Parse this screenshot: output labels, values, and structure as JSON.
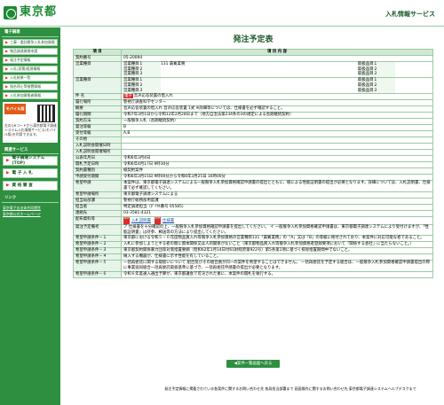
{
  "header": {
    "logo_text": "東京都",
    "service_title": "入札情報サービス"
  },
  "sidebar": {
    "heading": "電子調達",
    "menu": [
      "工事・委託競争入札参加資格",
      "物品調達資格申請",
      "発注予定情報",
      "入札(見積)経過情報",
      "入札結果一覧",
      "指名停止等措置情報",
      "入札参加資格者情報"
    ],
    "mobile_title": "モバイル版",
    "mobile_text": "左のQRコードから東京都電子調達システム入札情報サービス(モバイル版)を利用できます。",
    "heading2": "関連サービス",
    "btn1": "電子調達システム(TOP)",
    "btn2": "電 子 入 札",
    "btn3": "資 格 審 査",
    "heading3": "リンク",
    "links": [
      "東京電子自治体共同運営",
      "東京都公式ホームページ"
    ]
  },
  "main": {
    "page_title": "発注予定表",
    "col_item": "項 目",
    "col_content": "項 目 内 容",
    "rows": [
      {
        "label": "契約番号",
        "value": "05-20094"
      },
      {
        "label": "営業種目",
        "sub": [
          "営業種目１",
          "営業種目２",
          "営業種目３"
        ],
        "sub_val": [
          "131 貴賓業務",
          "",
          ""
        ],
        "right": [
          "取扱品目１",
          "取扱品目２",
          "取扱品目３"
        ]
      },
      {
        "label": "営業種目",
        "sub": [
          "営業種目１",
          "営業種目２",
          "営業種目３"
        ],
        "sub_val": [
          "",
          "",
          ""
        ],
        "right": [
          "取扱品目１",
          "取扱品目２",
          "取扱品目３"
        ]
      },
      {
        "label": "件 名",
        "badge": "電子",
        "value": "音声応答装置の借入れ"
      },
      {
        "label": "履行場所",
        "value": "警視庁調査科学センター"
      },
      {
        "label": "概要",
        "value": "音声応答装置の借入れ 音声応答装置 1式 ※詳細等については、仕様書を必ず確認すること。"
      },
      {
        "label": "履行期間",
        "value": "令和7年3月1日から令和12年2月28日まで（地方自治法第234条の3の規定による長期継続契約）"
      },
      {
        "label": "契約方法",
        "value": "一般競争入札（長期継続契約）"
      },
      {
        "label": "発注等級",
        "value": "B"
      },
      {
        "label": "受付等級",
        "value": "A,B"
      },
      {
        "label": "その他",
        "value": ""
      },
      {
        "label": "入札説明会開催日時",
        "value": ""
      },
      {
        "label": "入札説明会開催場所",
        "value": ""
      },
      {
        "label": "公表年月日",
        "value": "令和6年3月4日"
      },
      {
        "label": "開札予定日時",
        "value": "令和6年4月17日 9時30分"
      },
      {
        "label": "契約書種別",
        "value": "紙契約案件"
      },
      {
        "label": "申請受付期間",
        "value": "令和6年3月15日 9時00分から令和6年3月25日 16時00分"
      },
      {
        "label": "希望申請",
        "value": "本案件は、東京都電子調達システムによる一般競争入札参加資格確認申請書の提出とともに、紙による性能証明書の提出が必要となります。詳細については、入札説明書、仕様書で必ず確認してください。"
      },
      {
        "label": "希望申請場所",
        "value": "東京都電子調達システムによる"
      },
      {
        "label": "担当局部課",
        "value": "警視庁総務部用度課"
      },
      {
        "label": "担当者",
        "value": "特定調達担当（ﾀﾞｲﾔﾙ番号 05585）"
      },
      {
        "label": "連絡先",
        "value": "03-3581-4321"
      },
      {
        "label": "配布資料等",
        "pdfs": [
          "入札説明書",
          "仕様書"
        ]
      },
      {
        "label": "発注予定備考",
        "value": "ア 仕様書を十分確認の上、一般競争入札参加資格確認申請書を提出してください。 イ 一般競争入札参加資格確認申請書は、東京都電子調達システムにより受付けますが、「性能証明書」は持参、郵送等の方法により提出してください。"
      },
      {
        "label": "希望申請条件－１",
        "value": "東京都における令和５・６年度物品買入れ等競争入札参加資格の営業種目131「貴賓業務」の「A」又は「B」の等級に格付されており、本案件に対応可能な者であること。"
      },
      {
        "label": "希望申請条件－２",
        "value": "入札に参加しようとする者の間に資本関係又は人的関係がないこと（東京都物品買入れ等競争入札参加資格者登録要項において「関係する会社」に当たらないこと。）"
      },
      {
        "label": "希望申請条件－３",
        "value": "東京都契約関係暴力団等対策措置要綱（昭和62年1月14日付61財経庶第922号）第5条第1項に基づく排除措置期間中でないこと。"
      },
      {
        "label": "希望申請条件－４",
        "value": "納入する機器が、仕様書に示す性能を有していること。"
      },
      {
        "label": "希望申請条件－５",
        "value": "一括再委託に関する取扱いについて 組合及びその組合員が同一の案件を希望することはできません。 一括再委託を予定する組合は、一般競争入札参加資格確認申請書提出の際に事業協同組合一括再委託取扱基準に基づき、一括再委託申請書の提出が必要となります。"
      },
      {
        "label": "希望申請条件－６",
        "value": "令和６年度通入通出予算が、東京都議会で可決された後に、本案件の開札を執行する。"
      }
    ],
    "back_button": "案件一覧画面へ戻る",
    "footer": "発注予定情報に掲載されている各案件に関するお問い合わせ先 各局担当部署まで 画面操作に関するお問い合わせ先 東京都電子調達システムヘルプデスクまで"
  }
}
